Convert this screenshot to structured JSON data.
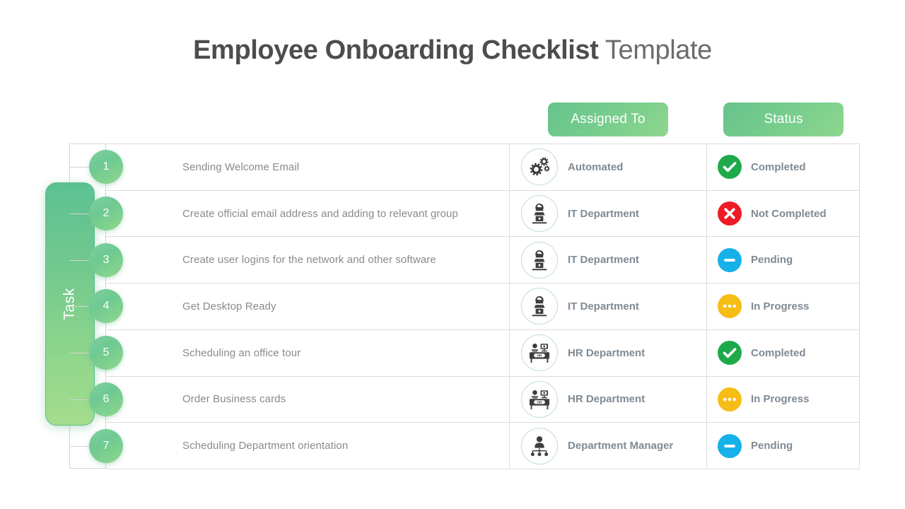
{
  "title": {
    "strong": "Employee Onboarding Checklist",
    "light": " Template"
  },
  "left_axis": {
    "label": "Task"
  },
  "columns": {
    "assigned_to": "Assigned To",
    "status": "Status"
  },
  "colors": {
    "header_pill_from": "#66c38c",
    "header_pill_to": "#8ed68e",
    "task_pill_from": "#5cc192",
    "task_pill_to": "#a4dd8c",
    "number_circle": "#6ec992",
    "icon_circle_border": "#bfe0c4",
    "status_completed": "#1eaa4b",
    "status_not_completed": "#ee1c25",
    "status_pending": "#16b1e8",
    "status_in_progress": "#f6bd16",
    "grid_line": "#dcdcdc",
    "title_text": "#4d4d4d",
    "task_text": "#8a8a8a",
    "label_text": "#7f8a94"
  },
  "rows": [
    {
      "number": "1",
      "task": "Sending Welcome Email",
      "assigned_to": "Automated",
      "assigned_icon": "gears-icon",
      "status": "Completed",
      "status_icon": "check-circle-icon",
      "status_color": "#1eaa4b"
    },
    {
      "number": "2",
      "task": "Create official email address and adding to relevant group",
      "assigned_to": "IT Department",
      "assigned_icon": "person-at-laptop-icon",
      "status": "Not Completed",
      "status_icon": "cross-circle-icon",
      "status_color": "#ee1c25"
    },
    {
      "number": "3",
      "task": "Create user logins for the network and other software",
      "assigned_to": "IT Department",
      "assigned_icon": "person-at-laptop-icon",
      "status": "Pending",
      "status_icon": "minus-circle-icon",
      "status_color": "#16b1e8"
    },
    {
      "number": "4",
      "task": "Get Desktop Ready",
      "assigned_to": "IT Department",
      "assigned_icon": "person-at-laptop-icon",
      "status": "In Progress",
      "status_icon": "ellipsis-circle-icon",
      "status_color": "#f6bd16"
    },
    {
      "number": "5",
      "task": "Scheduling an office tour",
      "assigned_to": "HR Department",
      "assigned_icon": "hr-desk-icon",
      "status": "Completed",
      "status_icon": "check-circle-icon",
      "status_color": "#1eaa4b"
    },
    {
      "number": "6",
      "task": "Order Business cards",
      "assigned_to": "HR Department",
      "assigned_icon": "hr-desk-icon",
      "status": "In Progress",
      "status_icon": "ellipsis-circle-icon",
      "status_color": "#f6bd16"
    },
    {
      "number": "7",
      "task": "Scheduling Department orientation",
      "assigned_to": "Department Manager",
      "assigned_icon": "org-chart-icon",
      "status": "Pending",
      "status_icon": "minus-circle-icon",
      "status_color": "#16b1e8"
    }
  ]
}
